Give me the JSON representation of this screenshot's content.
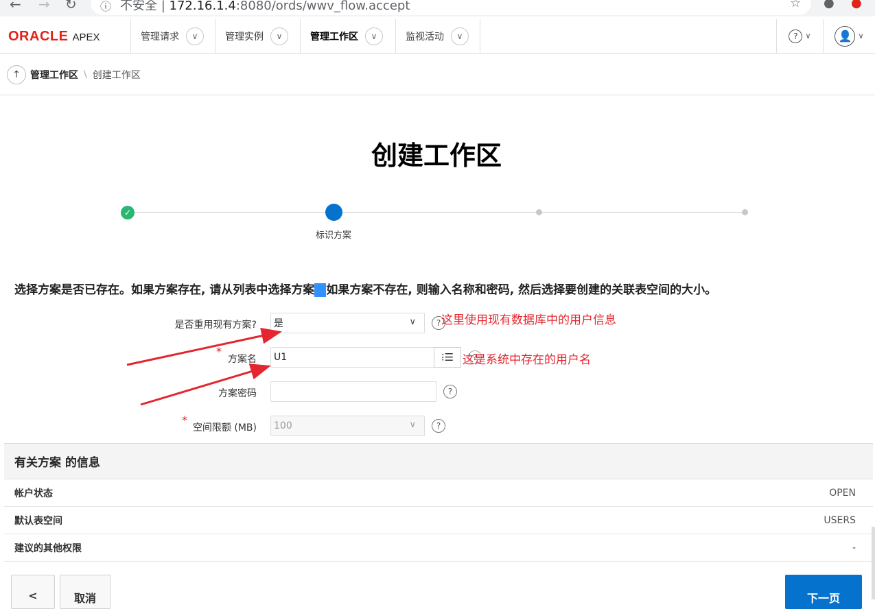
{
  "browser": {
    "insecure_label": "不安全",
    "url_host": "172.16.1.4",
    "url_rest": ":8080/ords/wwv_flow.accept"
  },
  "header": {
    "logo_oracle": "ORACLE",
    "logo_apex": "APEX",
    "menu": [
      {
        "label": "管理请求"
      },
      {
        "label": "管理实例"
      },
      {
        "label": "管理工作区"
      },
      {
        "label": "监视活动"
      }
    ]
  },
  "breadcrumb": {
    "parent": "管理工作区",
    "current": "创建工作区"
  },
  "page": {
    "title": "创建工作区",
    "wizard_step_label": "标识方案",
    "instruction_a": "选择方案是否已存在。如果方案存在, 请从列表中选择方案",
    "instruction_mark": "。",
    "instruction_b": "如果方案不存在, 则输入名称和密码, 然后选择要创建的关联表空间的大小。"
  },
  "form": {
    "reuse_label": "是否重用现有方案?",
    "reuse_value": "是",
    "schema_label": "方案名",
    "schema_value": "U1",
    "password_label": "方案密码",
    "password_value": "",
    "quota_label": "空间限额 (MB)",
    "quota_value": "100"
  },
  "annotations": {
    "note1": "这里使用现有数据库中的用户信息",
    "note2": "这是系统中存在的用户名"
  },
  "schema_info": {
    "title": "有关方案 的信息",
    "rows": [
      {
        "key": "帐户状态",
        "value": "OPEN"
      },
      {
        "key": "默认表空间",
        "value": "USERS"
      },
      {
        "key": "建议的其他权限",
        "value": "-"
      }
    ]
  },
  "buttons": {
    "back": "<",
    "cancel": "取消",
    "next": "下一页"
  },
  "colors": {
    "oracle_red": "#e2231a",
    "primary_blue": "#0572ce",
    "success_green": "#2bb673",
    "annotation_red": "#e3262f"
  }
}
